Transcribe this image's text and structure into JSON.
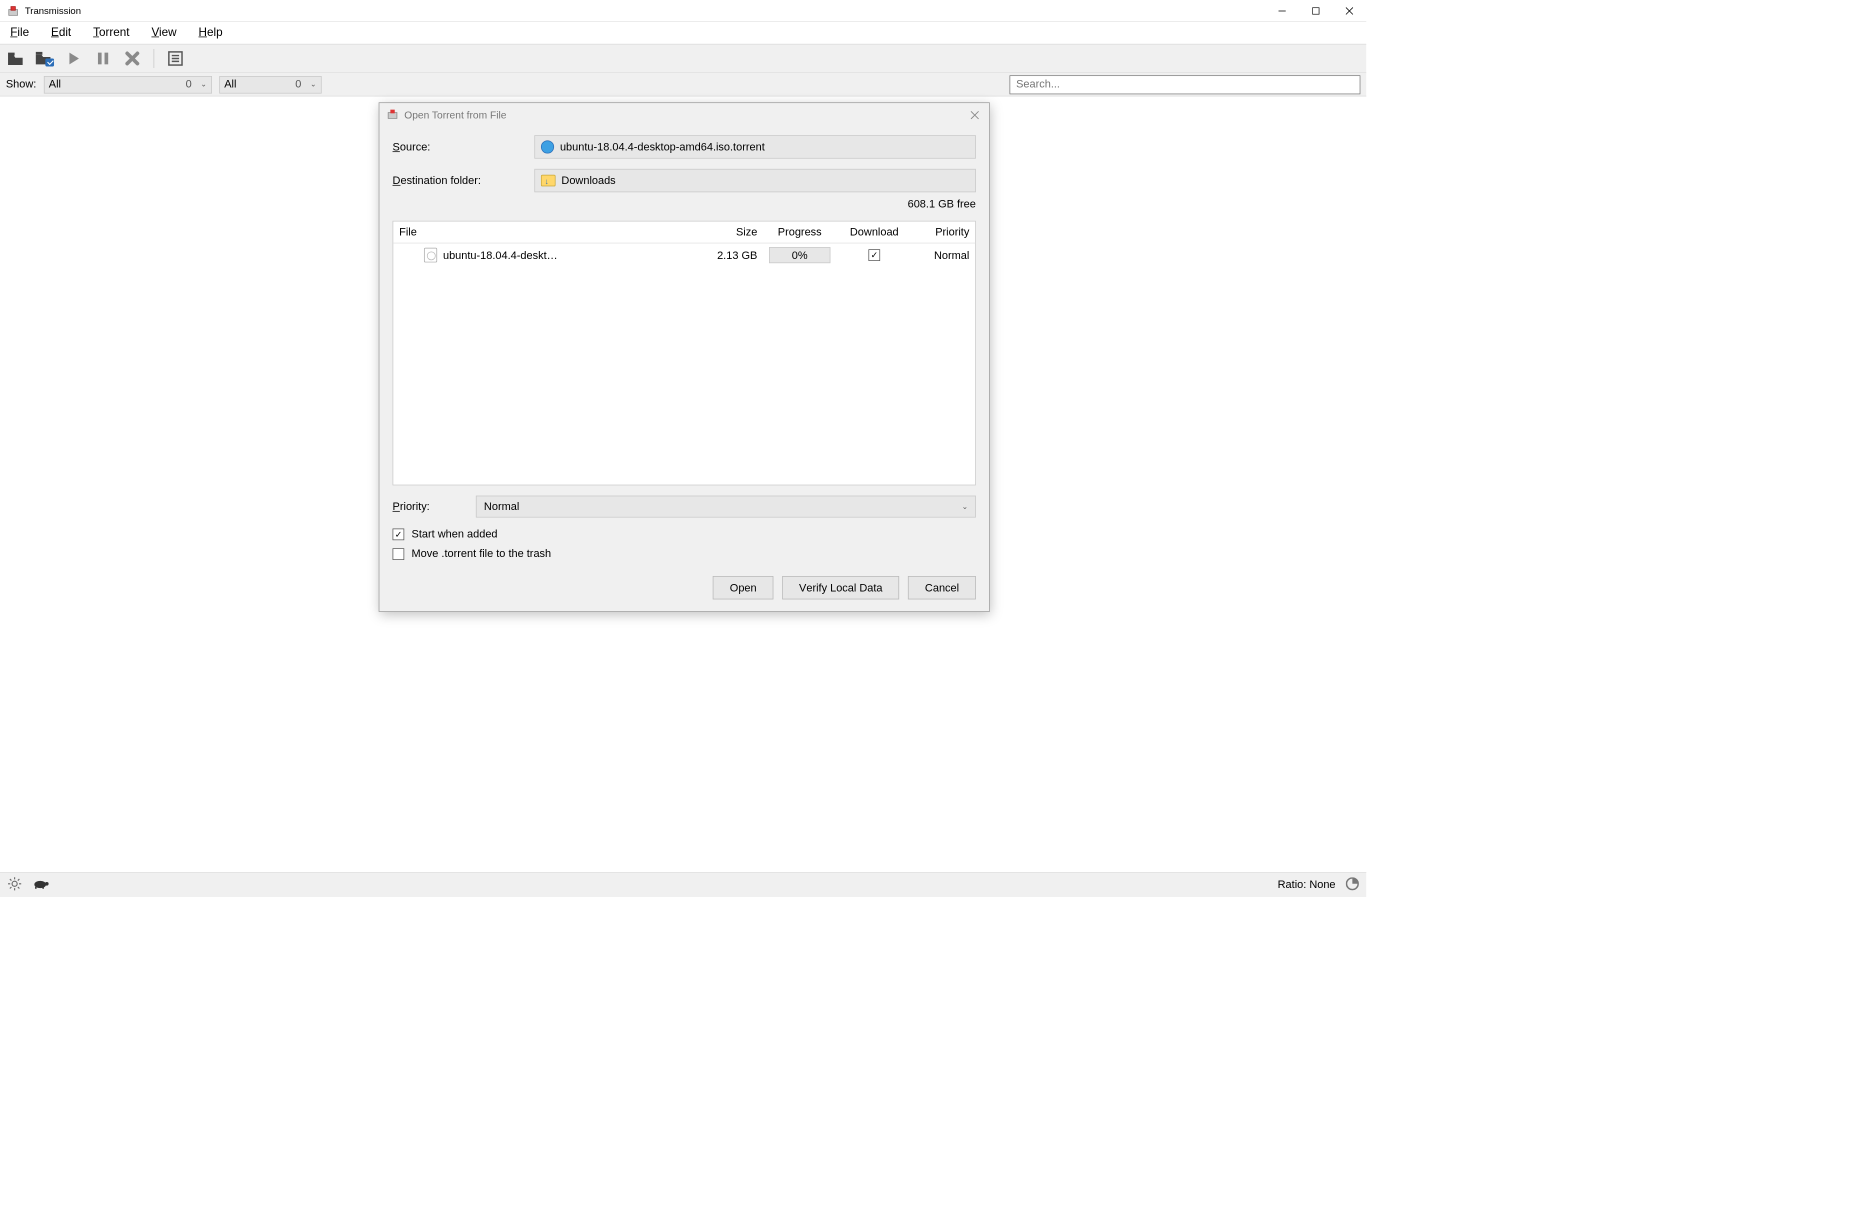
{
  "window": {
    "title": "Transmission"
  },
  "menu": {
    "file": "File",
    "edit": "Edit",
    "torrent": "Torrent",
    "view": "View",
    "help": "Help"
  },
  "filter": {
    "show_label": "Show:",
    "status_value": "All",
    "status_count": "0",
    "tracker_value": "All",
    "tracker_count": "0",
    "search_placeholder": "Search..."
  },
  "status": {
    "ratio": "Ratio: None"
  },
  "dialog": {
    "title": "Open Torrent from File",
    "source_label": "Source:",
    "source_value": "ubuntu-18.04.4-desktop-amd64.iso.torrent",
    "dest_label": "Destination folder:",
    "dest_value": "Downloads",
    "free_space": "608.1 GB free",
    "cols": {
      "file": "File",
      "size": "Size",
      "progress": "Progress",
      "download": "Download",
      "priority": "Priority"
    },
    "row": {
      "name": "ubuntu-18.04.4-deskt…",
      "size": "2.13 GB",
      "progress": "0%",
      "download_checked": true,
      "priority": "Normal"
    },
    "priority_label": "Priority:",
    "priority_value": "Normal",
    "start_when_added": "Start when added",
    "start_checked": true,
    "move_trash": "Move .torrent file to the trash",
    "move_checked": false,
    "buttons": {
      "open": "Open",
      "verify": "Verify Local Data",
      "cancel": "Cancel"
    }
  }
}
